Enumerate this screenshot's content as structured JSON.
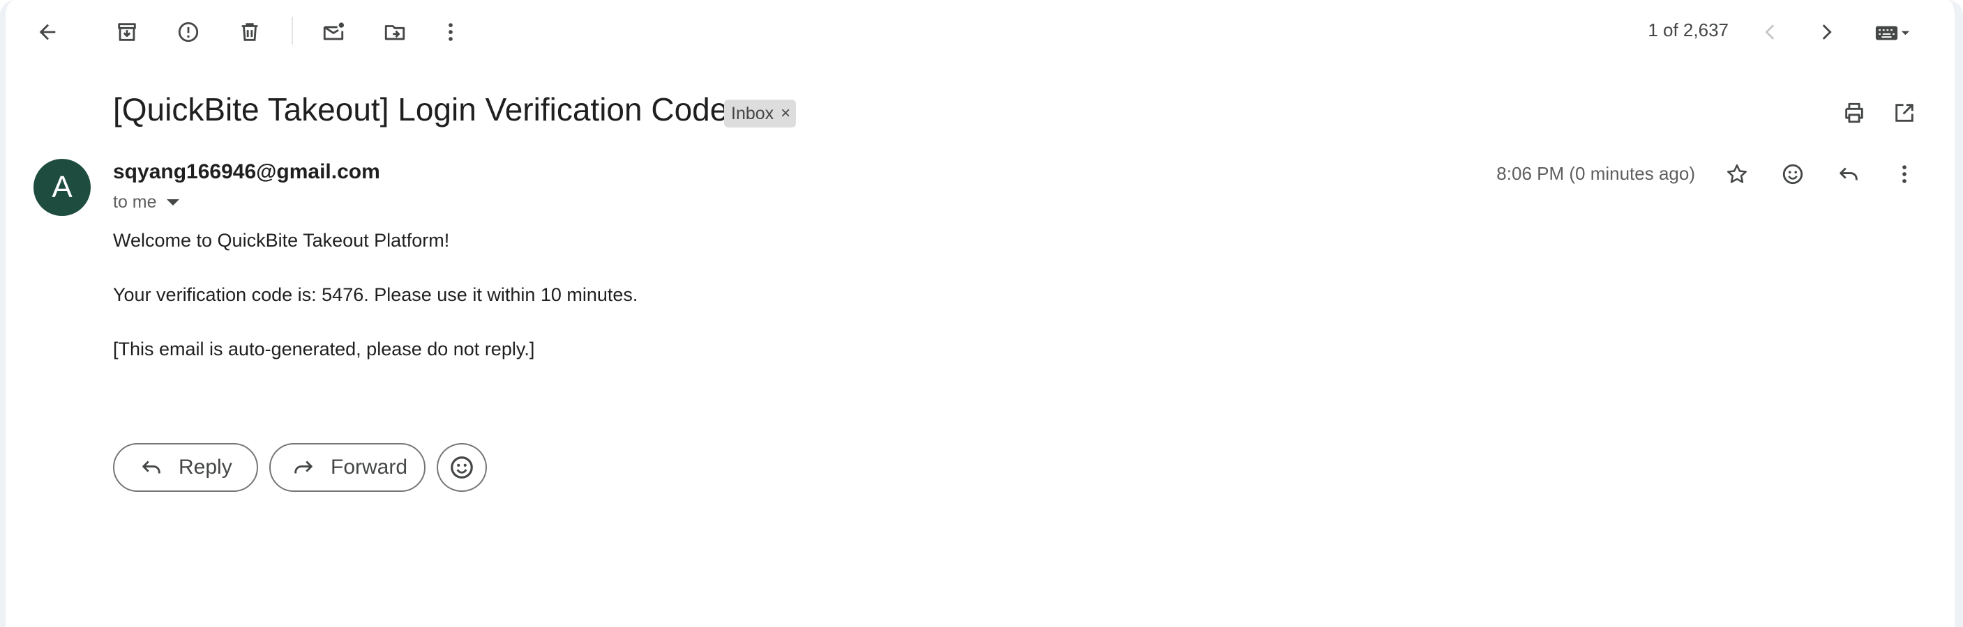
{
  "toolbar": {
    "back": "back-arrow-icon",
    "archive": "archive-icon",
    "report_spam": "report-spam-icon",
    "delete": "trash-icon",
    "mark_unread": "mark-unread-icon",
    "move_to": "move-to-folder-icon",
    "more": "more-vert-icon"
  },
  "pager": {
    "text": "1 of 2,637"
  },
  "email": {
    "subject": "[QuickBite Takeout] Login Verification Code",
    "label": "Inbox",
    "label_remove": "×",
    "avatar_letter": "A",
    "avatar_color": "#1e4d3f",
    "sender": "sqyang166946@gmail.com",
    "recipient": "to me",
    "timestamp": "8:06 PM (0 minutes ago)",
    "body": [
      "Welcome to QuickBite Takeout Platform!",
      "Your verification code is: 5476. Please use it within 10 minutes.",
      "[This email is auto-generated, please do not reply.]"
    ]
  },
  "actions": {
    "reply_label": "Reply",
    "forward_label": "Forward"
  }
}
